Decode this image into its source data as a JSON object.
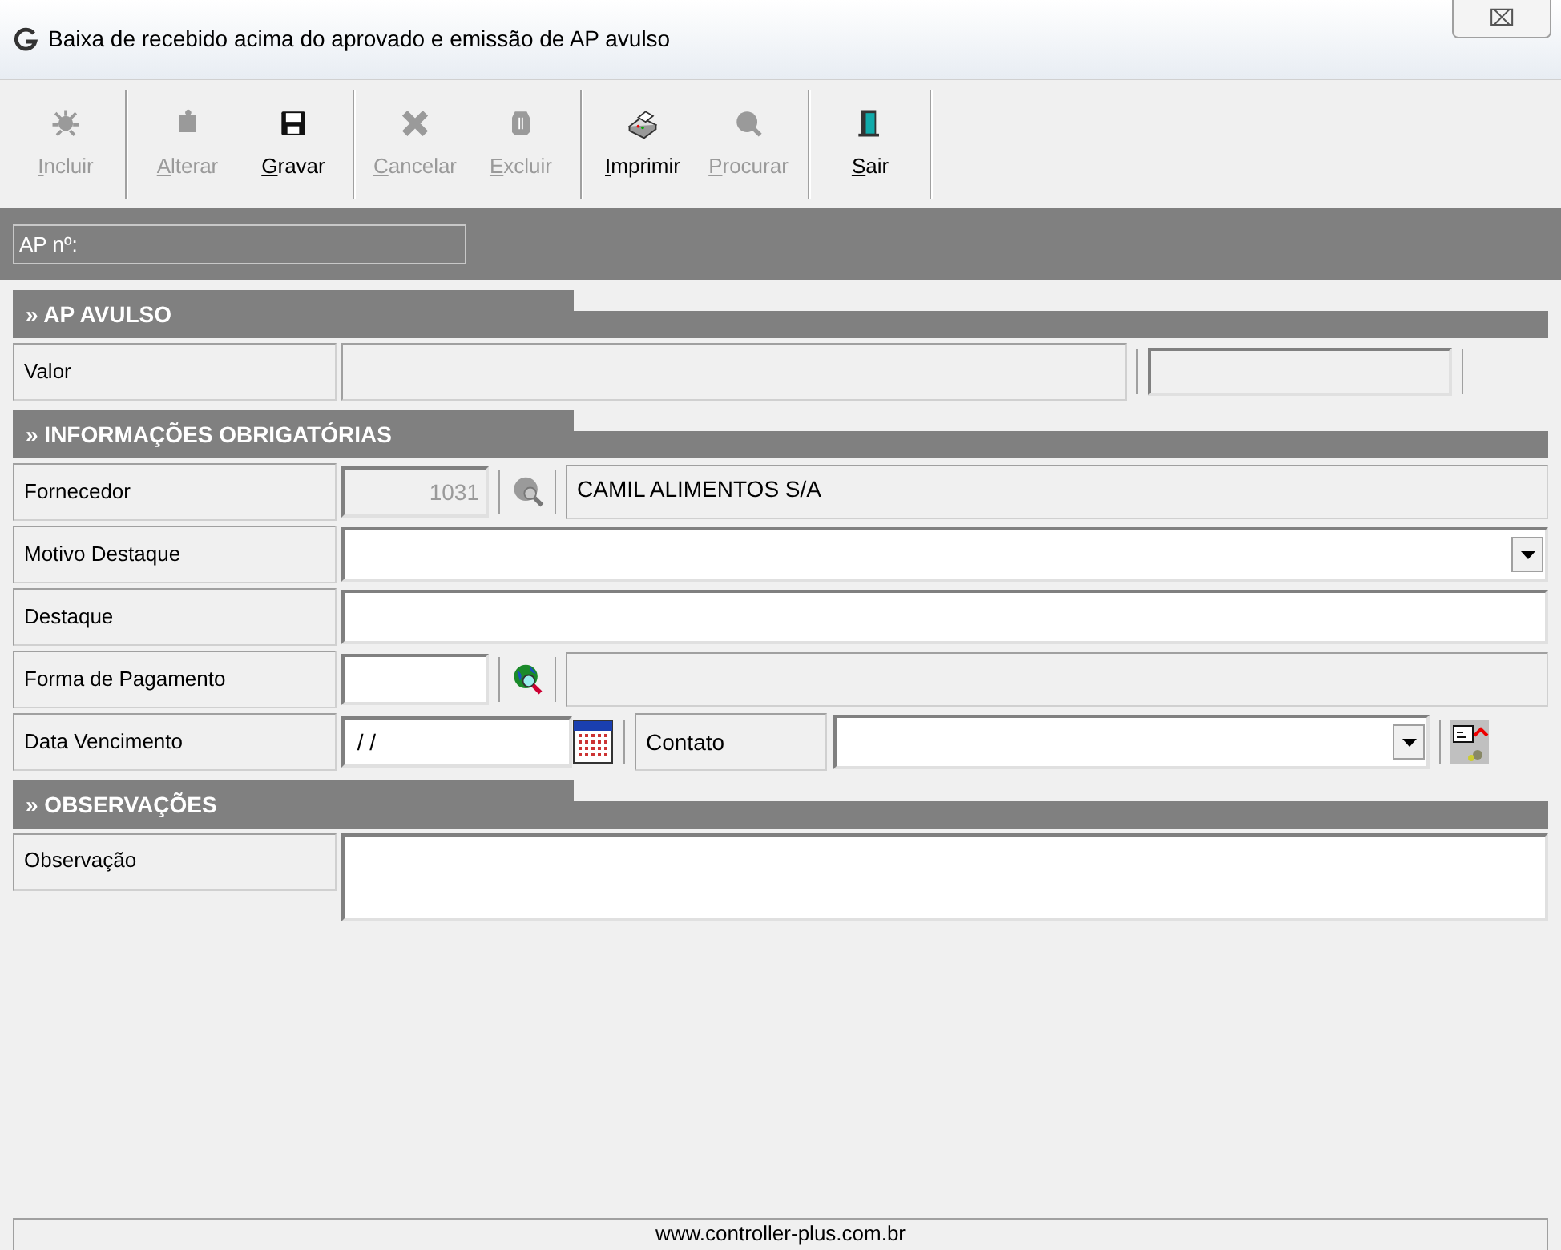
{
  "window": {
    "title": "Baixa de recebido acima do aprovado e emissão de AP avulso",
    "close": "⌧"
  },
  "toolbar": [
    {
      "label": "Incluir",
      "disabled": true
    },
    {
      "label": "Alterar",
      "disabled": true
    },
    {
      "label": "Gravar",
      "disabled": false
    },
    {
      "label": "Cancelar",
      "disabled": true
    },
    {
      "label": "Excluir",
      "disabled": true
    },
    {
      "label": "Imprimir",
      "disabled": false
    },
    {
      "label": "Procurar",
      "disabled": true
    },
    {
      "label": "Sair",
      "disabled": false
    }
  ],
  "ap_number": {
    "label": "AP nº:"
  },
  "sections": [
    {
      "title": "» AP AVULSO",
      "rows": [
        {
          "kind": "valor",
          "label": "Valor",
          "value": ""
        }
      ]
    },
    {
      "title": "» INFORMAÇÕES OBRIGATÓRIAS",
      "rows": [
        {
          "kind": "lookup",
          "label": "Fornecedor",
          "code": "1031",
          "name": "CAMIL ALIMENTOS S/A",
          "code_disabled": true
        },
        {
          "kind": "combo",
          "label": "Motivo Destaque",
          "value": ""
        },
        {
          "kind": "text",
          "label": "Destaque",
          "value": ""
        },
        {
          "kind": "lookup",
          "label": "Forma de Pagamento",
          "code": "",
          "name": "",
          "code_disabled": false
        },
        {
          "kind": "date",
          "label": "Data Vencimento",
          "value": " / /",
          "contact_label": "Contato",
          "contact_value": ""
        }
      ]
    },
    {
      "title": "» OBSERVAÇÕES",
      "rows": [
        {
          "kind": "memo",
          "label": "Observação",
          "value": ""
        }
      ]
    }
  ],
  "footer": "www.controller-plus.com.br"
}
